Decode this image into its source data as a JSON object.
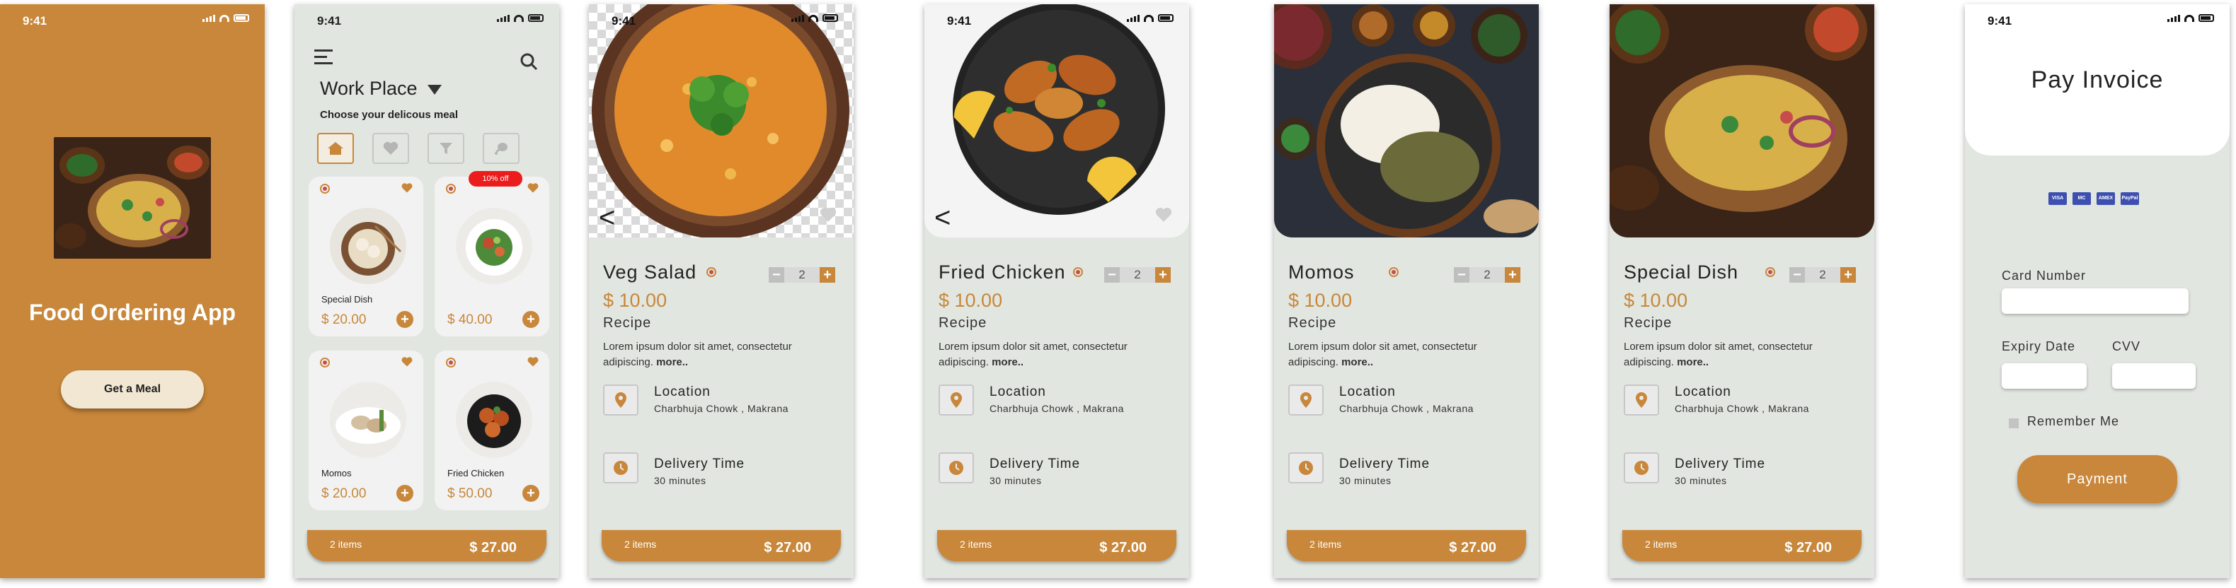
{
  "colors": {
    "accent": "#c8873a",
    "screen_bg": "#e2e6e0",
    "badge": "#ea1c1c"
  },
  "status_time": "9:41",
  "splash": {
    "title": "Food Ordering App",
    "button": "Get a Meal"
  },
  "home": {
    "place": "Work Place",
    "subtitle": "Choose your delicous meal",
    "categories": [
      "home-icon",
      "heart-icon",
      "filter-icon",
      "chicken-icon"
    ],
    "items": [
      {
        "name": "Special Dish",
        "price": "$ 20.00",
        "badge": ""
      },
      {
        "name": "",
        "price": "$ 40.00",
        "badge": "10% off"
      },
      {
        "name": "Momos",
        "price": "$ 20.00",
        "badge": ""
      },
      {
        "name": "Fried Chicken",
        "price": "$ 50.00",
        "badge": ""
      }
    ],
    "cart": {
      "items": "2 items",
      "total": "$ 27.00"
    }
  },
  "details": [
    {
      "title": "Veg Salad",
      "price": "$ 10.00",
      "qty": "2",
      "recipe": "Recipe",
      "desc": "Lorem ipsum dolor sit amet, consectetur adipiscing.",
      "more": "more..",
      "location_label": "Location",
      "location_value": "Charbhuja Chowk , Makrana",
      "delivery_label": "Delivery Time",
      "delivery_value": "30 minutes",
      "back": "<",
      "cart_items": "2 items",
      "cart_total": "$ 27.00"
    },
    {
      "title": "Fried Chicken",
      "price": "$ 10.00",
      "qty": "2",
      "recipe": "Recipe",
      "desc": "Lorem ipsum dolor sit amet, consectetur adipiscing.",
      "more": "more..",
      "location_label": "Location",
      "location_value": "Charbhuja Chowk , Makrana",
      "delivery_label": "Delivery Time",
      "delivery_value": "30 minutes",
      "back": "<",
      "cart_items": "2 items",
      "cart_total": "$ 27.00"
    },
    {
      "title": "Momos",
      "price": "$ 10.00",
      "qty": "2",
      "recipe": "Recipe",
      "desc": "Lorem ipsum dolor sit amet, consectetur adipiscing.",
      "more": "more..",
      "location_label": "Location",
      "location_value": "Charbhuja Chowk , Makrana",
      "delivery_label": "Delivery Time",
      "delivery_value": "30 minutes",
      "back": "",
      "cart_items": "2 items",
      "cart_total": "$ 27.00"
    },
    {
      "title": "Special Dish",
      "price": "$ 10.00",
      "qty": "2",
      "recipe": "Recipe",
      "desc": "Lorem ipsum dolor sit amet, consectetur adipiscing.",
      "more": "more..",
      "location_label": "Location",
      "location_value": "Charbhuja Chowk , Makrana",
      "delivery_label": "Delivery Time",
      "delivery_value": "30 minutes",
      "back": "",
      "cart_items": "2 items",
      "cart_total": "$ 27.00"
    }
  ],
  "pay": {
    "title": "Pay Invoice",
    "card_brands": [
      "VISA",
      "MC",
      "AMEX",
      "PayPal"
    ],
    "card_number_label": "Card Number",
    "expiry_label": "Expiry Date",
    "cvv_label": "CVV",
    "remember_label": "Remember  Me",
    "button": "Payment"
  }
}
